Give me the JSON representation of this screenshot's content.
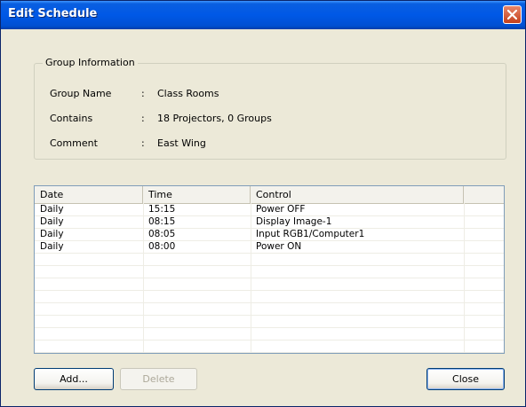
{
  "window": {
    "title": "Edit Schedule"
  },
  "group": {
    "legend": "Group Information",
    "fields": [
      {
        "label": "Group Name",
        "sep": ":",
        "value": "Class Rooms"
      },
      {
        "label": "Contains",
        "sep": ":",
        "value": "18 Projectors, 0 Groups"
      },
      {
        "label": "Comment",
        "sep": ":",
        "value": "East Wing"
      }
    ]
  },
  "schedule": {
    "columns": [
      "Date",
      "Time",
      "Control",
      ""
    ],
    "rows": [
      [
        "Daily",
        "15:15",
        "Power OFF"
      ],
      [
        "Daily",
        "08:15",
        "Display Image-1"
      ],
      [
        "Daily",
        "08:05",
        "Input RGB1/Computer1"
      ],
      [
        "Daily",
        "08:00",
        "Power ON"
      ]
    ]
  },
  "buttons": {
    "add": "Add...",
    "delete": "Delete",
    "close": "Close"
  },
  "colors": {
    "titlebar": "#0058e6",
    "close_button": "#c4401c",
    "face": "#ece9d8",
    "list_border": "#7f9db9"
  }
}
